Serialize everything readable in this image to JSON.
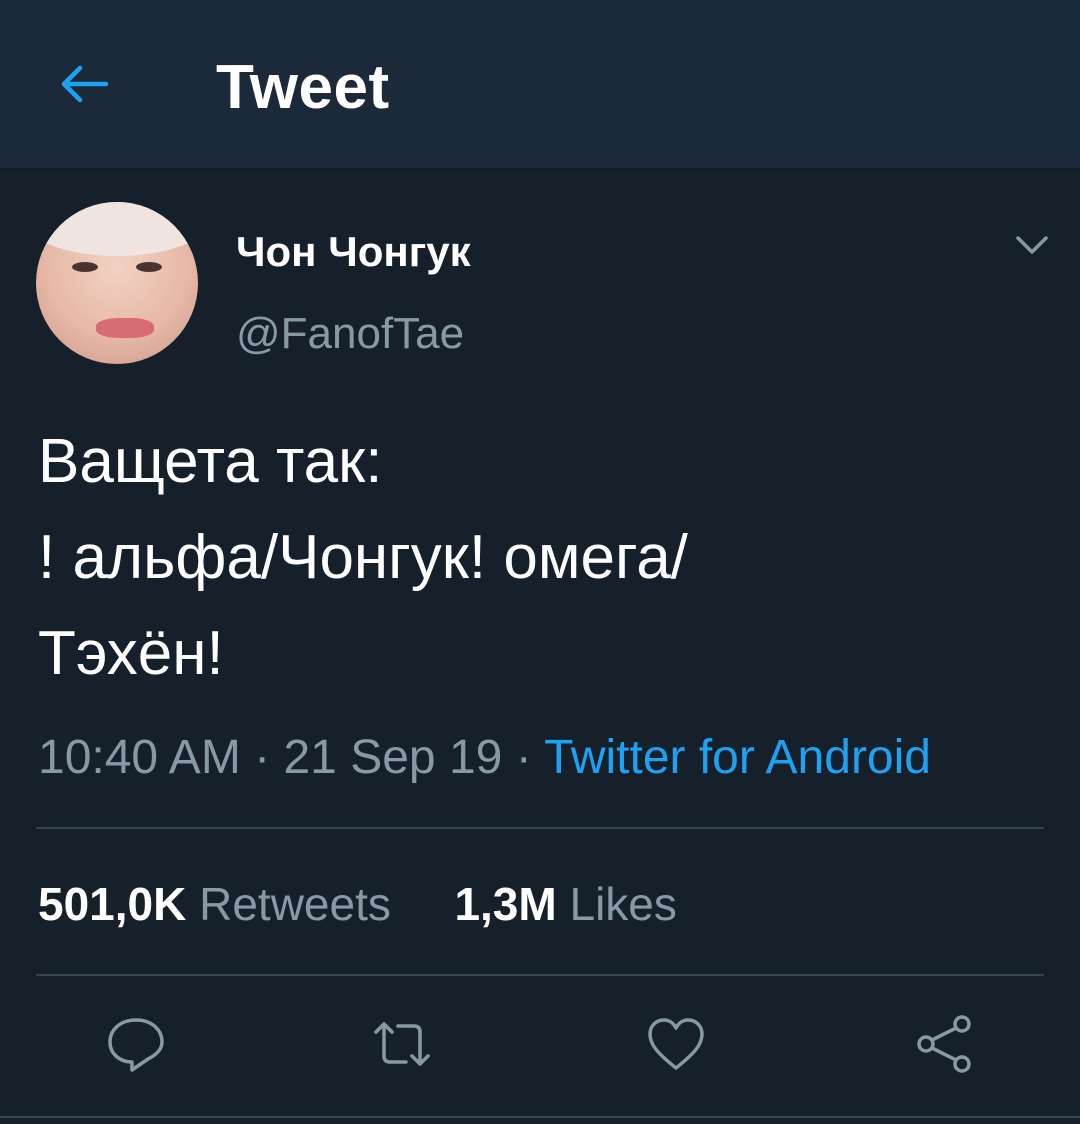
{
  "header": {
    "title": "Tweet",
    "back_icon": "arrow-left-icon",
    "accent_color": "#1da1f2"
  },
  "tweet": {
    "author": {
      "display_name": "Чон Чонгук",
      "handle": "@FanofTae"
    },
    "text_lines": [
      "Ващета так:",
      "! альфа/Чонгук! омега/",
      "Тэхён!"
    ],
    "time": "10:40 AM",
    "separator": "·",
    "date": "21 Sep 19",
    "source": "Twitter for Android",
    "stats": {
      "retweets_count": "501,0K",
      "retweets_label": "Retweets",
      "likes_count": "1,3M",
      "likes_label": "Likes"
    },
    "actions": [
      "reply-icon",
      "retweet-icon",
      "like-icon",
      "share-icon"
    ]
  },
  "colors": {
    "background": "#15202b",
    "header_background": "#1c2938",
    "secondary_text": "#8899a6",
    "divider": "#38444d"
  }
}
